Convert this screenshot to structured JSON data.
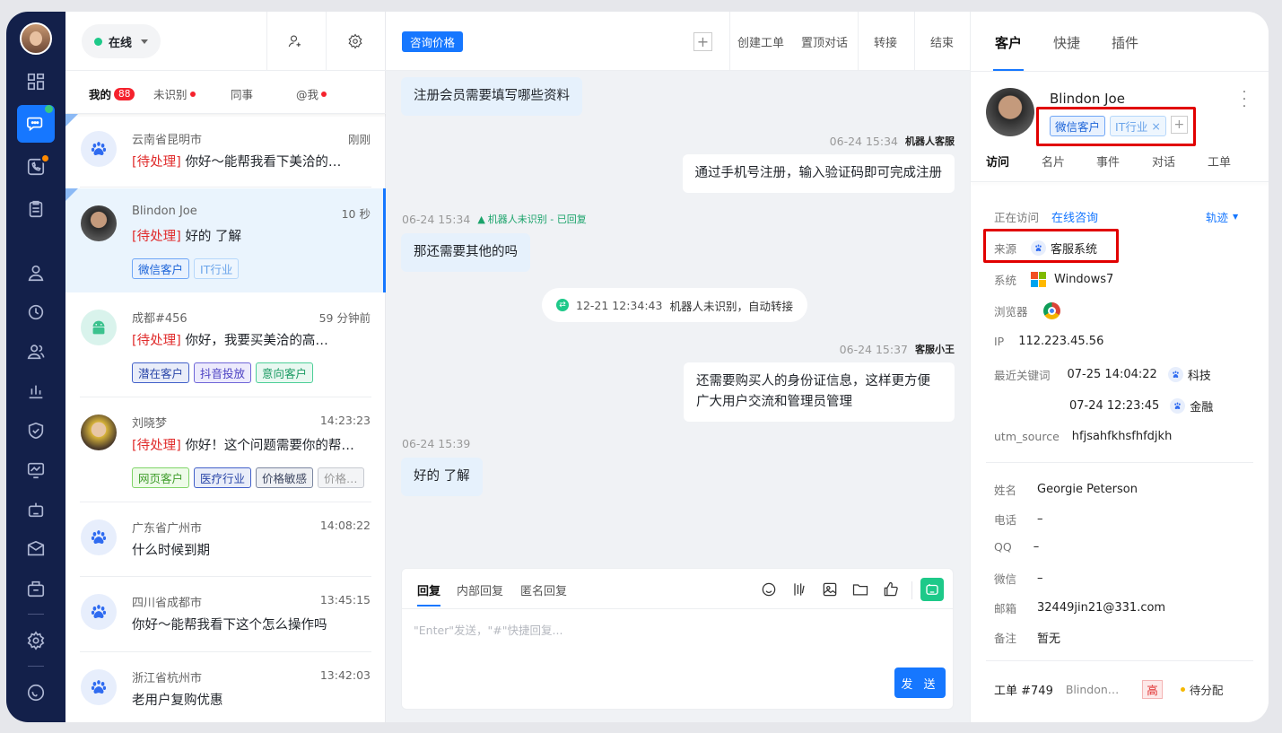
{
  "status": {
    "label": "在线"
  },
  "conversation_tabs": [
    {
      "label": "我的",
      "count": "88"
    },
    {
      "label": "未识别"
    },
    {
      "label": "同事"
    },
    {
      "label": "@我"
    }
  ],
  "conversations": [
    {
      "name": "云南省昆明市",
      "time": "刚刚",
      "tag": "[待处理]",
      "message": "你好～能帮我看下美洽的…",
      "avatar": "paw-icon",
      "tags": []
    },
    {
      "name": "Blindon Joe",
      "time": "10 秒",
      "tag": "[待处理]",
      "message": "好的 了解",
      "avatar": "photo",
      "tags": [
        {
          "label": "微信客户"
        },
        {
          "label": "IT行业"
        }
      ]
    },
    {
      "name": "成都#456",
      "time": "59 分钟前",
      "tag": "[待处理]",
      "message": "你好，我要买美洽的高…",
      "avatar": "android-icon",
      "tags": [
        {
          "label": "潜在客户"
        },
        {
          "label": "抖音投放"
        },
        {
          "label": "意向客户"
        }
      ]
    },
    {
      "name": "刘晓梦",
      "time": "14:23:23",
      "tag": "[待处理]",
      "message": "你好！这个问题需要你的帮…",
      "avatar": "photo",
      "tags": [
        {
          "label": "网页客户"
        },
        {
          "label": "医疗行业"
        },
        {
          "label": "价格敏感"
        },
        {
          "label": "价格…"
        }
      ]
    },
    {
      "name": "广东省广州市",
      "time": "14:08:22",
      "message": "什么时候到期",
      "avatar": "paw-icon",
      "tags": []
    },
    {
      "name": "四川省成都市",
      "time": "13:45:15",
      "message": "你好～能帮我看下这个怎么操作吗",
      "avatar": "paw-icon",
      "tags": []
    },
    {
      "name": "浙江省杭州市",
      "time": "13:42:03",
      "message": "老用户复购优惠",
      "avatar": "paw-icon",
      "tags": []
    }
  ],
  "chat": {
    "topic": "咨询价格",
    "actions": [
      "创建工单",
      "置顶对话",
      "转接",
      "结束"
    ],
    "messages": [
      {
        "text": "注册会员需要填写哪些资料"
      },
      {
        "time": "06-24 15:34",
        "sender": "机器人客服",
        "text": "通过手机号注册，输入验证码即可完成注册"
      },
      {
        "time": "06-24 15:34",
        "warning": "机器人未识别 - 已回复",
        "text": "那还需要其他的吗"
      },
      {
        "system_time": "12-21 12:34:43",
        "system_text": "机器人未识别，自动转接"
      },
      {
        "time": "06-24 15:37",
        "sender": "客服小王",
        "text": "还需要购买人的身份证信息，这样更方便广大用户交流和管理员管理"
      },
      {
        "time": "06-24 15:39",
        "text": "好的 了解"
      }
    ],
    "reply_tabs": [
      "回复",
      "内部回复",
      "匿名回复"
    ],
    "placeholder": "\"Enter\"发送，\"#\"快捷回复...",
    "send_label": "发 送"
  },
  "panel": {
    "tabs": [
      "客户",
      "快捷",
      "插件"
    ],
    "customer_name": "Blindon Joe",
    "tags": [
      {
        "label": "微信客户"
      },
      {
        "label": "IT行业"
      }
    ],
    "subtabs": [
      "访问",
      "名片",
      "事件",
      "对话",
      "工单"
    ],
    "visit": {
      "visiting_label": "正在访问",
      "visiting_value": "在线咨询",
      "trace_label": "轨迹",
      "source_label": "来源",
      "source_value": "客服系统",
      "os_label": "系统",
      "os_value": "Windows7",
      "browser_label": "浏览器",
      "ip_label": "IP",
      "ip_value": "112.223.45.56",
      "keywords_label": "最近关键词",
      "keywords": [
        {
          "time": "07-25 14:04:22",
          "word": "科技"
        },
        {
          "time": "07-24 12:23:45",
          "word": "金融"
        }
      ],
      "utm_label": "utm_source",
      "utm_value": "hfjsahfkhsfhfdjkh"
    },
    "profile": [
      {
        "label": "姓名",
        "value": "Georgie Peterson"
      },
      {
        "label": "电话",
        "value": "–"
      },
      {
        "label": "QQ",
        "value": "–"
      },
      {
        "label": "微信",
        "value": "–"
      },
      {
        "label": "邮箱",
        "value": "32449jin21@331.com"
      },
      {
        "label": "备注",
        "value": "暂无"
      }
    ],
    "ticket": {
      "id": "工单 #749",
      "name": "Blindon…",
      "priority": "高",
      "status": "待分配"
    }
  },
  "colors": {
    "brand": "#1677ff",
    "rail": "#13204a",
    "pending": "#e02b2b",
    "online": "#1ec989"
  }
}
